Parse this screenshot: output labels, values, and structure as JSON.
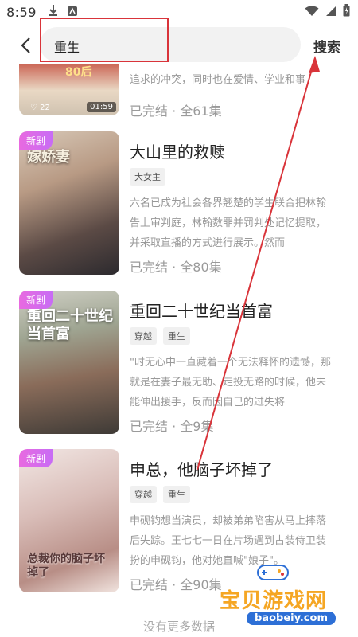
{
  "status_bar": {
    "time": "8:59"
  },
  "search": {
    "query": "重生",
    "button_label": "搜索"
  },
  "results": [
    {
      "cover_caption": "80后",
      "cover_likes": "22",
      "cover_duration": "01:59",
      "title": "",
      "tags": [],
      "description": "追求的冲突，同时也在爱情、学业和事",
      "meta": "已完结 · 全61集"
    },
    {
      "badge": "新剧",
      "cover_caption": "嫁娇妻",
      "title": "大山里的救赎",
      "tags": [
        "大女主"
      ],
      "description": "六名已成为社会各界翘楚的学生联合把林翰告上审判庭，林翰数罪并罚判处记忆提取，并采取直播的方式进行展示。然而",
      "meta": "已完结 · 全80集"
    },
    {
      "badge": "新剧",
      "cover_caption": "重回二十世纪当首富",
      "title": "重回二十世纪当首富",
      "tags": [
        "穿越",
        "重生"
      ],
      "description": "\"时无心中一直藏着一个无法释怀的遗憾，那就是在妻子最无助、走投无路的时候，他未能伸出援手，反而因自己的过失将",
      "meta": "已完结 · 全9集"
    },
    {
      "badge": "新剧",
      "cover_caption": "总裁你的脑子坏掉了",
      "title": "申总，他脑子坏掉了",
      "tags": [
        "穿越",
        "重生"
      ],
      "description": "申砚钧想当演员，却被弟弟陷害从马上摔落后失踪。王七七一日在片场遇到古装侍卫装扮的申砚钧，他对她直喊\"娘子\"。",
      "meta": "已完结 · 全90集"
    }
  ],
  "footer": "没有更多数据",
  "watermark": {
    "text": "宝贝游戏网",
    "url": "baobeiy.com"
  },
  "colors": {
    "highlight": "#d9343a",
    "badge": "#d06cf0",
    "watermark": "#f5a623"
  }
}
